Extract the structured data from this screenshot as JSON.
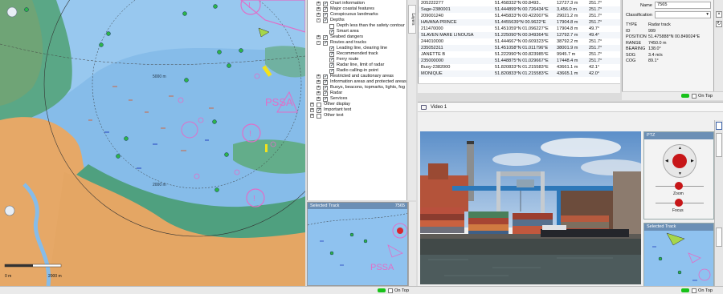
{
  "chart": {
    "scale_labels": [
      "0 m",
      "2000 m"
    ],
    "depth_labels": [
      "5000 m",
      "2000 m"
    ],
    "pssa_label": "PSSA"
  },
  "layers": {
    "items": [
      {
        "label": "Chart information",
        "indent": 1,
        "checked": true,
        "expand": "+"
      },
      {
        "label": "Major coastal features",
        "indent": 1,
        "checked": true,
        "expand": "+"
      },
      {
        "label": "Conspicuous landmarks",
        "indent": 1,
        "checked": true,
        "expand": "+"
      },
      {
        "label": "Depths",
        "indent": 1,
        "checked": true,
        "expand": "-"
      },
      {
        "label": "Depth less than the safety contour",
        "indent": 2,
        "checked": false,
        "expand": ""
      },
      {
        "label": "Smart area",
        "indent": 2,
        "checked": true,
        "expand": ""
      },
      {
        "label": "Seabed dangers",
        "indent": 1,
        "checked": true,
        "expand": "+"
      },
      {
        "label": "Routes and tracks",
        "indent": 1,
        "checked": true,
        "expand": "-"
      },
      {
        "label": "Leading line, clearing line",
        "indent": 2,
        "checked": true,
        "expand": ""
      },
      {
        "label": "Recommended track",
        "indent": 2,
        "checked": true,
        "expand": ""
      },
      {
        "label": "Ferry route",
        "indent": 2,
        "checked": true,
        "expand": ""
      },
      {
        "label": "Radar line, limit of radar",
        "indent": 2,
        "checked": true,
        "expand": ""
      },
      {
        "label": "Radio calling-in point",
        "indent": 2,
        "checked": true,
        "expand": ""
      },
      {
        "label": "Restricted and cautionary areas",
        "indent": 1,
        "checked": true,
        "expand": "+"
      },
      {
        "label": "Information areas and protected areas",
        "indent": 1,
        "checked": true,
        "expand": "+"
      },
      {
        "label": "Buoys, beacons, topmarks, lights, fog",
        "indent": 1,
        "checked": true,
        "expand": "+"
      },
      {
        "label": "Radar",
        "indent": 1,
        "checked": true,
        "expand": "+"
      },
      {
        "label": "Services",
        "indent": 1,
        "checked": true,
        "expand": "+"
      },
      {
        "label": "Other display",
        "indent": 0,
        "checked": false,
        "expand": "+"
      },
      {
        "label": "Important text",
        "indent": 0,
        "checked": true,
        "expand": "+"
      },
      {
        "label": "Other text",
        "indent": 0,
        "checked": false,
        "expand": "+"
      }
    ],
    "tab_label": "Layers"
  },
  "selected_track": {
    "title": "Selected Track",
    "track_id": "7565",
    "pssa_label": "PSSA"
  },
  "table": {
    "rows": [
      [
        "205222277",
        "51.458332°N 00.8493..",
        "12727.3 m",
        "251.7°"
      ],
      [
        "Sage-2380001",
        "51.444899°N 00.726434°E",
        "3,456.0 m",
        "251.7°"
      ],
      [
        "209001240",
        "51.445833°N 00.422007°E",
        "29021.2 m",
        "251.7°"
      ],
      [
        "HAVANA PRINCE",
        "51.4455639°N 00.9622°E",
        "17904.8 m",
        "251.7°"
      ],
      [
        "211470000",
        "51.451059°N 01.096227°E",
        "17904.8 m",
        "49.7°"
      ],
      [
        "SLAVEN MARE LINOUSA",
        "51.225090°N 00.949364°E",
        "12792.7 m",
        "49.4°"
      ],
      [
        "244010000",
        "51.444667°N 00.609323°E",
        "38792.2 m",
        "251.7°"
      ],
      [
        "235052311",
        "51.451058°N 01.011796°E",
        "38001.9 m",
        "251.7°"
      ],
      [
        "JANETTE B",
        "51.222990°N 00.823985°E",
        "9945.7 m",
        "251.7°"
      ],
      [
        "235000000",
        "51.448875°N 01.029667°E",
        "17448.4 m",
        "251.7°"
      ],
      [
        "Buoy-2382000",
        "51.820833°N 01.215583°E",
        "43661.1 m",
        "42.1°"
      ],
      [
        "MONIQUE",
        "51.820833°N 01.215583°E",
        "43665.1 m",
        "42.0°"
      ]
    ]
  },
  "properties": {
    "name_label": "Name",
    "name_value": "7565",
    "classification_label": "Classification",
    "rows": [
      [
        "TYPE",
        "Radar track"
      ],
      [
        "ID",
        "999"
      ],
      [
        "POSITION",
        "51.475888°N 00.849024°E"
      ],
      [
        "RANGE",
        "7450.0 m"
      ],
      [
        "BEARING",
        "138.0°"
      ],
      [
        "SOG",
        "3.4 m/s"
      ],
      [
        "COG",
        "89.1°"
      ]
    ]
  },
  "ontop_label": "On Top",
  "video": {
    "title": "Video 1",
    "ptz_title": "PTZ",
    "zoom_label": "Zoom",
    "focus_label": "Focus",
    "selected_track_title": "Selected Track"
  }
}
